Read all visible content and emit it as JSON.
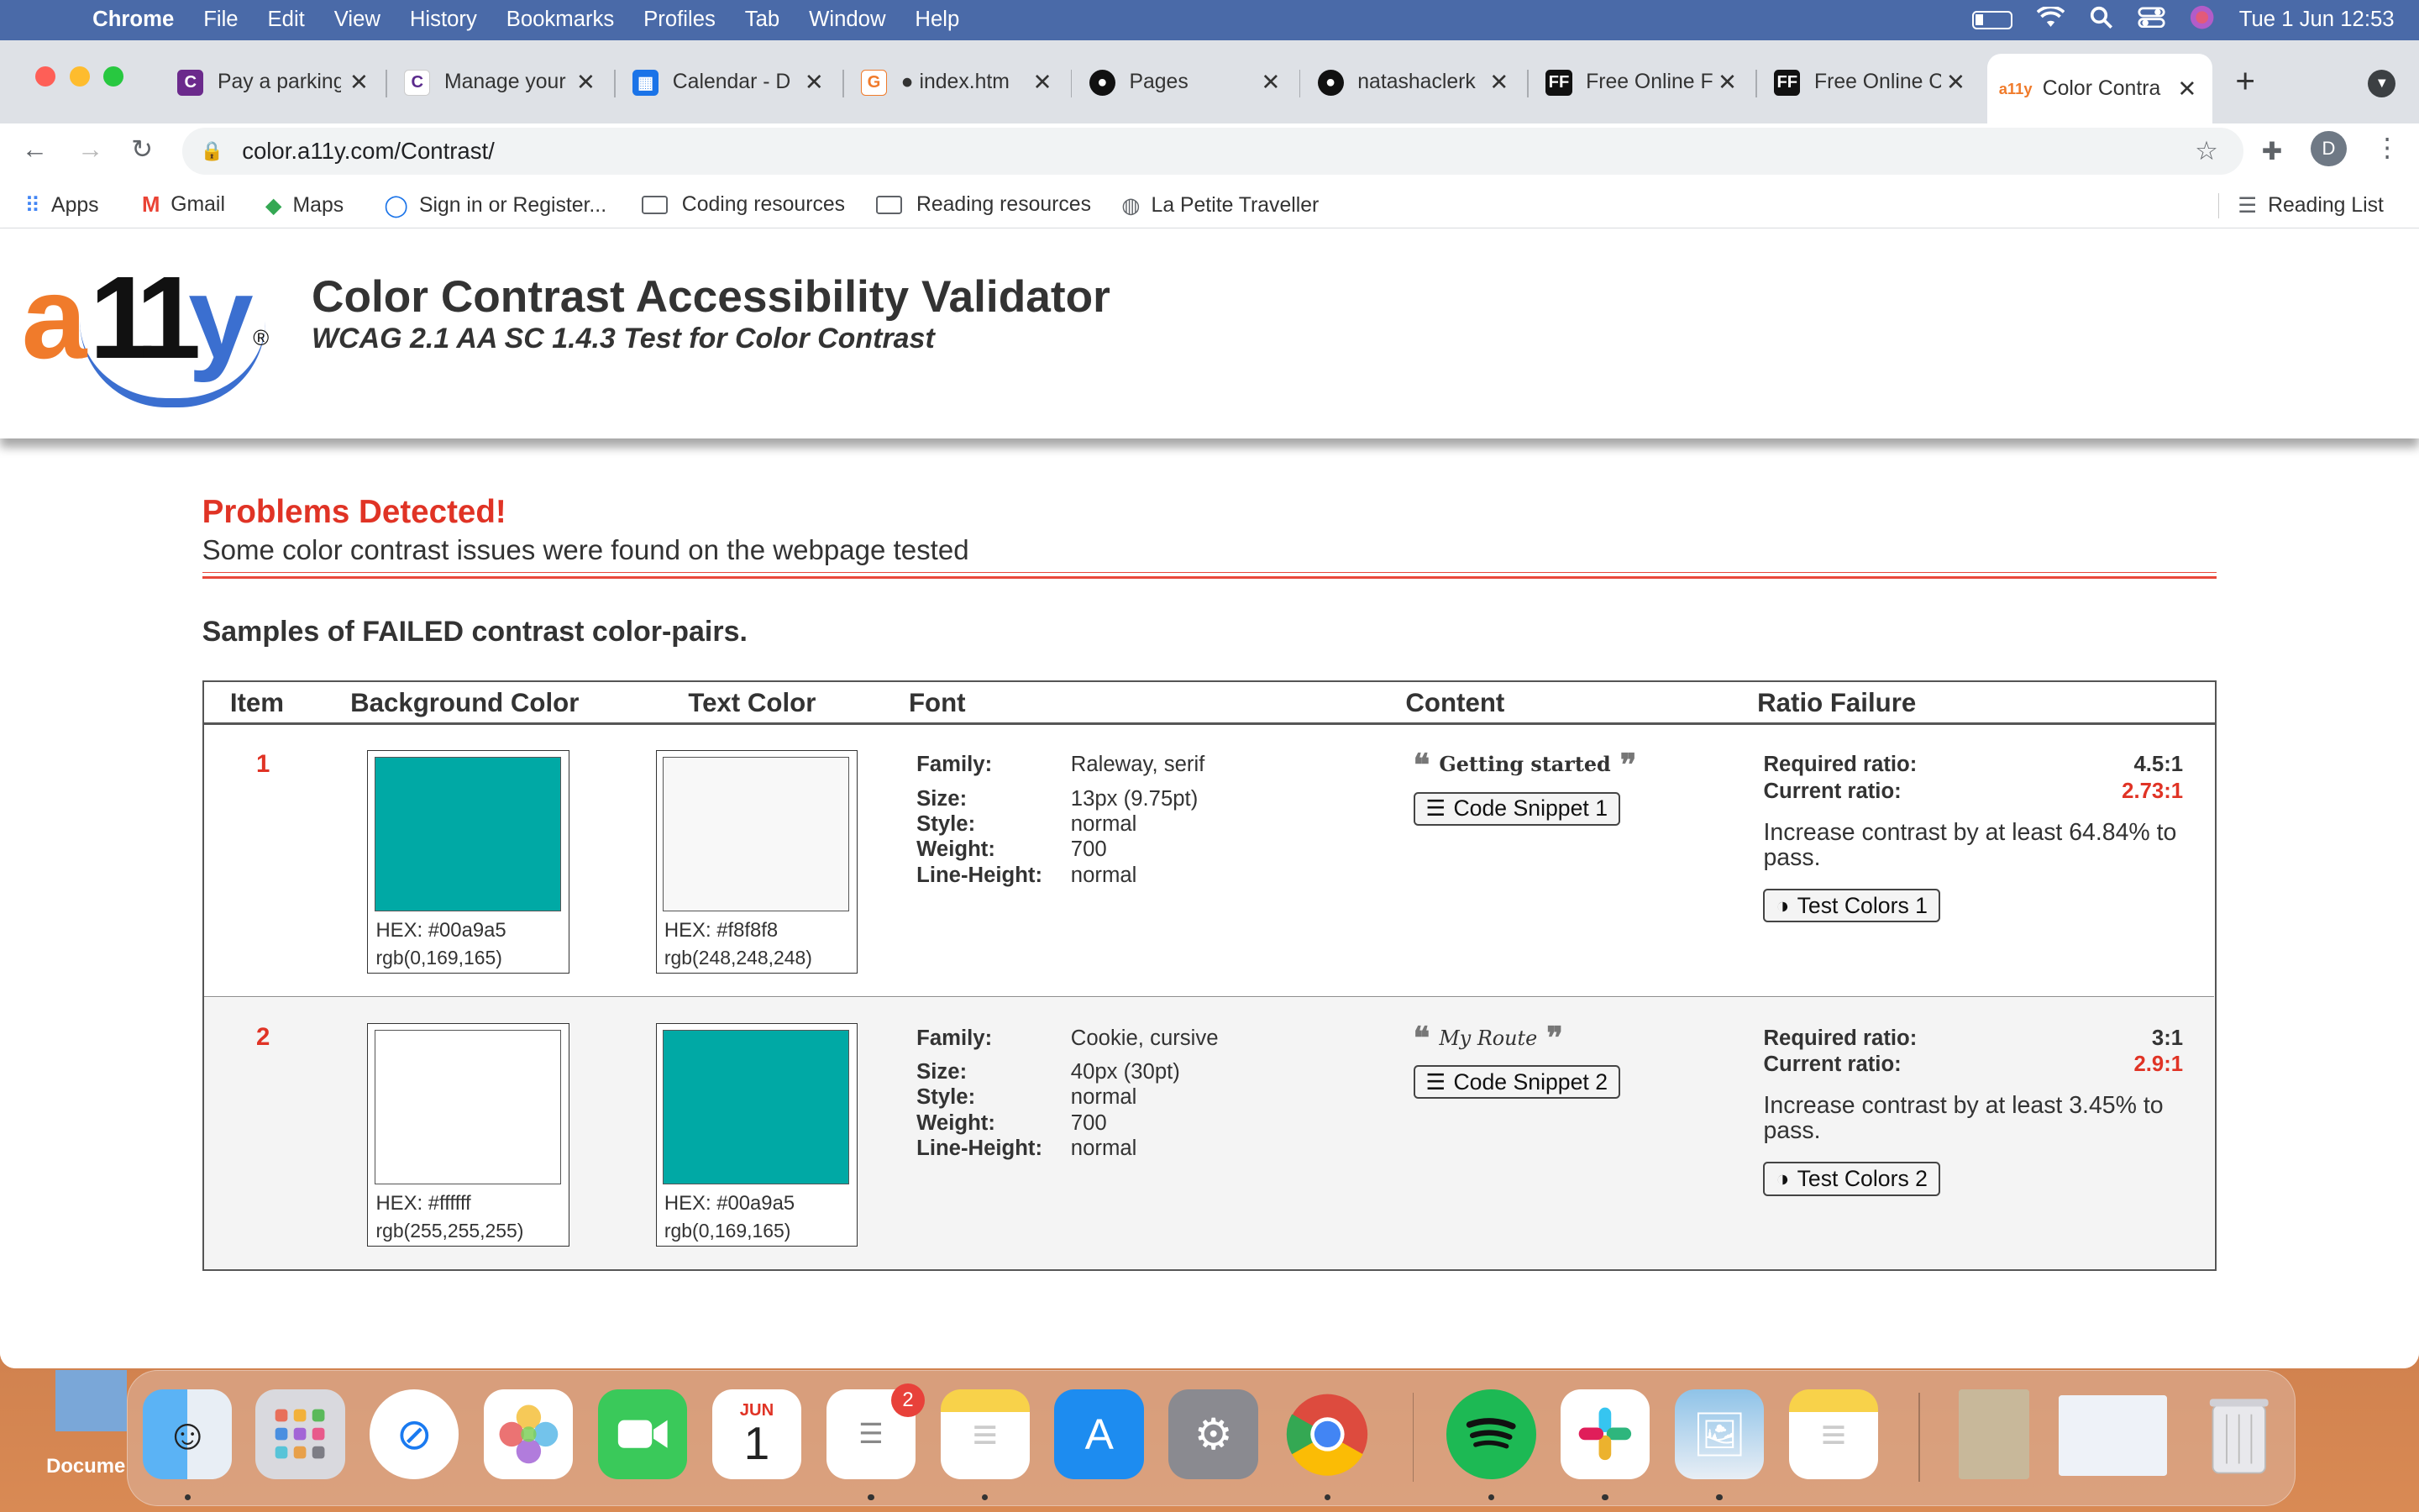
{
  "menubar": {
    "app": "Chrome",
    "items": [
      "File",
      "Edit",
      "View",
      "History",
      "Bookmarks",
      "Profiles",
      "Tab",
      "Window",
      "Help"
    ],
    "clock": "Tue 1 Jun  12:53"
  },
  "tabs": [
    {
      "title": "Pay a parking",
      "icon": "c-purple-icon"
    },
    {
      "title": "Manage your",
      "icon": "c-white-icon"
    },
    {
      "title": "Calendar - D",
      "icon": "calendar-icon"
    },
    {
      "title": "● index.htm",
      "icon": "editor-icon"
    },
    {
      "title": "Pages",
      "icon": "github-icon"
    },
    {
      "title": "natashaclerk",
      "icon": "github-icon"
    },
    {
      "title": "Free Online F",
      "icon": "ff-icon"
    },
    {
      "title": "Free Online C",
      "icon": "ff-icon"
    },
    {
      "title": "Color Contra",
      "icon": "a11y-icon",
      "active": true
    }
  ],
  "omnibox": {
    "url": "color.a11y.com/Contrast/"
  },
  "profile_initial": "D",
  "bookmarks": {
    "items": [
      "Apps",
      "Gmail",
      "Maps",
      "Sign in or Register...",
      "Coding resources",
      "Reading resources",
      "La Petite Traveller"
    ],
    "reading_list": "Reading List"
  },
  "header": {
    "logo": "a11y",
    "title": "Color Contrast Accessibility Validator",
    "subtitle": "WCAG 2.1 AA SC 1.4.3 Test for Color Contrast"
  },
  "status": {
    "heading": "Problems Detected!",
    "description": "Some color contrast issues were found on the webpage tested"
  },
  "samples_heading": "Samples of FAILED contrast color-pairs.",
  "table": {
    "headers": [
      "Item",
      "Background Color",
      "Text Color",
      "Font",
      "Content",
      "Ratio Failure"
    ],
    "font_keys": {
      "family": "Family:",
      "size": "Size:",
      "style": "Style:",
      "weight": "Weight:",
      "line_height": "Line-Height:"
    },
    "ratio_keys": {
      "required": "Required ratio:",
      "current": "Current ratio:"
    },
    "rows": [
      {
        "item": "1",
        "bg": {
          "color": "#00a9a5",
          "hex": "HEX: #00a9a5",
          "rgb": "rgb(0,169,165)"
        },
        "fg": {
          "color": "#f8f8f8",
          "hex": "HEX: #f8f8f8",
          "rgb": "rgb(248,248,248)"
        },
        "font": {
          "family": "Raleway, serif",
          "size": "13px (9.75pt)",
          "style": "normal",
          "weight": "700",
          "line_height": "normal"
        },
        "content": "Getting started",
        "snippet_button": "Code Snippet 1",
        "required_ratio": "4.5:1",
        "current_ratio": "2.73:1",
        "advice": "Increase contrast by at least 64.84% to pass.",
        "test_button": "Test Colors 1"
      },
      {
        "item": "2",
        "bg": {
          "color": "#ffffff",
          "hex": "HEX: #ffffff",
          "rgb": "rgb(255,255,255)"
        },
        "fg": {
          "color": "#00a9a5",
          "hex": "HEX: #00a9a5",
          "rgb": "rgb(0,169,165)"
        },
        "font": {
          "family": "Cookie, cursive",
          "size": "40px (30pt)",
          "style": "normal",
          "weight": "700",
          "line_height": "normal"
        },
        "content": "My Route",
        "snippet_button": "Code Snippet 2",
        "required_ratio": "3:1",
        "current_ratio": "2.9:1",
        "advice": "Increase contrast by at least 3.45% to pass.",
        "test_button": "Test Colors 2"
      }
    ]
  },
  "dock": {
    "calendar_month": "JUN",
    "calendar_day": "1",
    "reminders_badge": "2"
  },
  "desktop_label": "Docume"
}
